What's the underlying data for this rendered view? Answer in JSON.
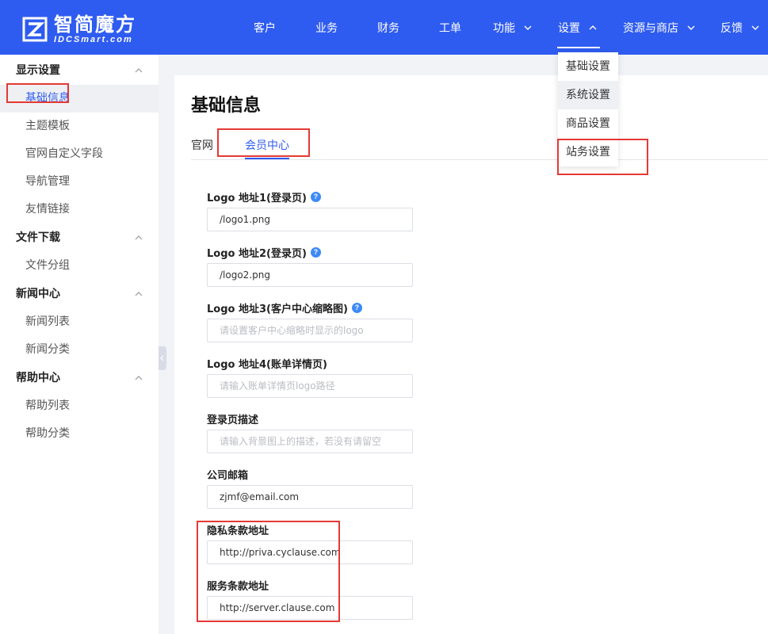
{
  "brand": {
    "name_cn": "智简魔方",
    "name_en": "IDCSmart.com"
  },
  "nav": [
    {
      "label": "客户"
    },
    {
      "label": "业务"
    },
    {
      "label": "财务"
    },
    {
      "label": "工单"
    },
    {
      "label": "功能"
    },
    {
      "label": "设置"
    },
    {
      "label": "资源与商店"
    },
    {
      "label": "反馈"
    }
  ],
  "dropdown": {
    "items": [
      {
        "label": "基础设置"
      },
      {
        "label": "系统设置"
      },
      {
        "label": "商品设置"
      },
      {
        "label": "站务设置"
      }
    ]
  },
  "sidebar": {
    "groups": [
      {
        "title": "显示设置",
        "items": [
          "基础信息",
          "主题模板",
          "官网自定义字段",
          "导航管理",
          "友情链接"
        ]
      },
      {
        "title": "文件下载",
        "items": [
          "文件分组"
        ]
      },
      {
        "title": "新闻中心",
        "items": [
          "新闻列表",
          "新闻分类"
        ]
      },
      {
        "title": "帮助中心",
        "items": [
          "帮助列表",
          "帮助分类"
        ]
      }
    ]
  },
  "page": {
    "title": "基础信息",
    "tabs": [
      {
        "label": "官网"
      },
      {
        "label": "会员中心"
      }
    ]
  },
  "form": {
    "fields": [
      {
        "label": "Logo 地址1(登录页)",
        "value": "/logo1.png",
        "placeholder": ""
      },
      {
        "label": "Logo 地址2(登录页)",
        "value": "/logo2.png",
        "placeholder": ""
      },
      {
        "label": "Logo 地址3(客户中心缩略图)",
        "value": "",
        "placeholder": "请设置客户中心缩略时显示的logo"
      },
      {
        "label": "Logo 地址4(账单详情页)",
        "value": "",
        "placeholder": "请输入账单详情页logo路径"
      },
      {
        "label": "登录页描述",
        "value": "",
        "placeholder": "请输入背景图上的描述，若没有请留空"
      },
      {
        "label": "公司邮箱",
        "value": "zjmf@email.com",
        "placeholder": ""
      },
      {
        "label": "隐私条款地址",
        "value": "http://priva.cyclause.com",
        "placeholder": ""
      },
      {
        "label": "服务条款地址",
        "value": "http://server.clause.com",
        "placeholder": ""
      }
    ]
  },
  "colors": {
    "brand_blue": "#2f5cf0",
    "highlight_red": "#e53935",
    "help_icon": "#3d8af7"
  }
}
